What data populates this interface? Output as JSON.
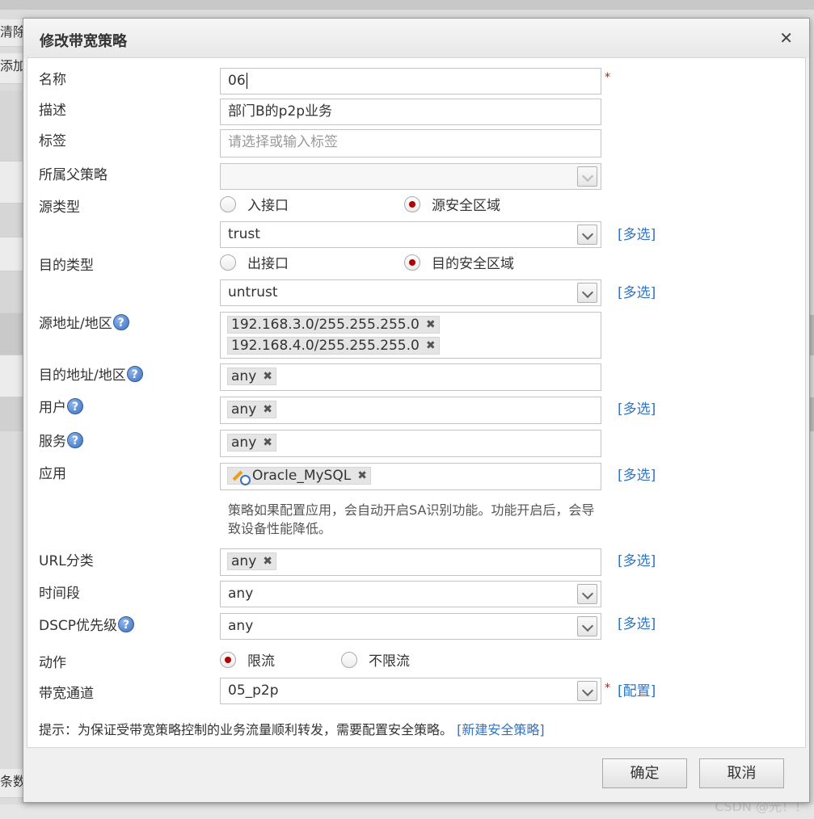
{
  "background": {
    "strip_clear": "清除",
    "strip_add": "添加",
    "strip_count": "条数"
  },
  "watermark": "CSDN @光！！",
  "dialog": {
    "title": "修改带宽策略",
    "close_label": "✕",
    "fields": {
      "name": {
        "label": "名称",
        "value": "06"
      },
      "description": {
        "label": "描述",
        "value": "部门B的p2p业务"
      },
      "tag": {
        "label": "标签",
        "placeholder": "请选择或输入标签"
      },
      "parent_policy": {
        "label": "所属父策略",
        "value": ""
      },
      "source_type": {
        "label": "源类型",
        "options": [
          "入接口",
          "源安全区域"
        ],
        "selected": "源安全区域",
        "zone": "trust"
      },
      "dest_type": {
        "label": "目的类型",
        "options": [
          "出接口",
          "目的安全区域"
        ],
        "selected": "目的安全区域",
        "zone": "untrust"
      },
      "source_address": {
        "label": "源地址/地区",
        "tags": [
          "192.168.3.0/255.255.255.0",
          "192.168.4.0/255.255.255.0"
        ]
      },
      "dest_address": {
        "label": "目的地址/地区",
        "tags": [
          "any"
        ]
      },
      "user": {
        "label": "用户",
        "tags": [
          "any"
        ]
      },
      "service": {
        "label": "服务",
        "tags": [
          "any"
        ]
      },
      "application": {
        "label": "应用",
        "tags": [
          "Oracle_MySQL"
        ]
      },
      "app_hint": "策略如果配置应用，会自动开启SA识别功能。功能开启后，会导致设备性能降低。",
      "url_category": {
        "label": "URL分类",
        "tags": [
          "any"
        ]
      },
      "time_range": {
        "label": "时间段",
        "value": "any"
      },
      "dscp": {
        "label": "DSCP优先级",
        "value": "any"
      },
      "action": {
        "label": "动作",
        "options": [
          "限流",
          "不限流"
        ],
        "selected": "限流"
      },
      "bandwidth_channel": {
        "label": "带宽通道",
        "value": "05_p2p"
      }
    },
    "links": {
      "multi_select": "[多选]",
      "configure": "[配置]"
    },
    "required_mark": "*",
    "help_mark": "?",
    "tag_remove": "✖",
    "footer_note": {
      "text": "提示：为保证受带宽策略控制的业务流量顺利转发，需要配置安全策略。",
      "link": "[新建安全策略]"
    },
    "buttons": {
      "ok": "确定",
      "cancel": "取消"
    }
  },
  "colors": {
    "link": "#2c74c8",
    "required": "#e00000",
    "radio_dot": "#b00000"
  },
  "icons": {
    "close": "close-icon",
    "help": "help-icon",
    "dropdown": "chevron-down-icon",
    "remove": "remove-tag-icon",
    "app": "application-icon"
  }
}
